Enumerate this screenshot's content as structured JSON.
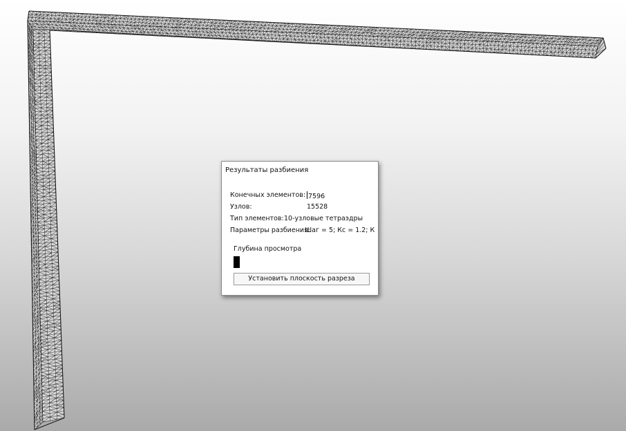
{
  "panel": {
    "title": "Результаты разбиения",
    "elements_label": "Конечных элементов:",
    "elements_value": "7596",
    "nodes_label": "Узлов:",
    "nodes_value": "15528",
    "type_label": "Тип элементов:",
    "type_value": "10-узловые тетраэдры",
    "params_label": "Параметры разбиения:",
    "params_value": "Шаг = 5; Кс = 1.2; К",
    "depth_label": "Глубина просмотра",
    "section_button": "Установить плоскость разреза"
  },
  "mesh": {
    "edge_color": "#1a1a1a",
    "face_color": "#d8d8d8"
  }
}
